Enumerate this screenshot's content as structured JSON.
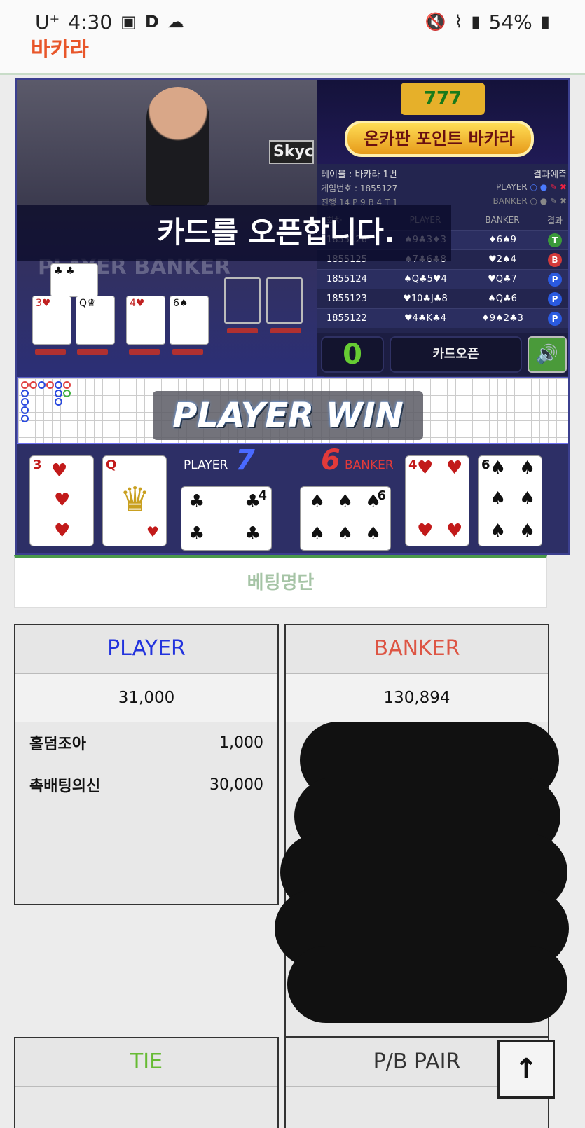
{
  "status_bar": {
    "carrier": "U⁺",
    "time": "4:30",
    "battery": "54%"
  },
  "header": {
    "logo": "바카라"
  },
  "video": {
    "announcement": "카드를 오픈합니다.",
    "watermark": "Skyc",
    "ghost_label": "PLAYER BANKER"
  },
  "banner": {
    "slots": "777",
    "title": "온카판 포인트 바카라"
  },
  "info": {
    "table": "테이블 : 바카라 1번",
    "prediction_label": "결과예측",
    "game_no": "게임번호 : 1855127",
    "player_label": "PLAYER",
    "banker_label": "BANKER",
    "progress": "진행 14  P 9  B 4  T 1",
    "columns": [
      "회차",
      "PLAYER",
      "BANKER",
      "결과"
    ],
    "rows": [
      {
        "num": "1855126",
        "player": "♠9♣3♦3",
        "banker": "♦6♠9",
        "result": "T",
        "color": "#3a9a3a"
      },
      {
        "num": "1855125",
        "player": "♠7♣6♣8",
        "banker": "♥2♠4",
        "result": "B",
        "color": "#d43a3a"
      },
      {
        "num": "1855124",
        "player": "♠Q♣5♥4",
        "banker": "♥Q♣7",
        "result": "P",
        "color": "#2a5ae0"
      },
      {
        "num": "1855123",
        "player": "♥10♣J♣8",
        "banker": "♠Q♣6",
        "result": "P",
        "color": "#2a5ae0"
      },
      {
        "num": "1855122",
        "player": "♥4♣K♣4",
        "banker": "♦9♠2♣3",
        "result": "P",
        "color": "#2a5ae0"
      }
    ]
  },
  "controls": {
    "counter": "0",
    "open_label": "카드오픈",
    "sound_icon": "speaker-icon"
  },
  "result": {
    "banner": "PLAYER WIN",
    "player_label": "PLAYER",
    "player_score": "7",
    "banker_label": "BANKER",
    "banker_score": "6",
    "player_cards": [
      {
        "rank": "3",
        "suit": "♥"
      },
      {
        "rank": "Q",
        "suit": "♥"
      },
      {
        "rank": "4",
        "suit": "♣"
      }
    ],
    "banker_cards": [
      {
        "rank": "6",
        "suit": "♠"
      },
      {
        "rank": "4",
        "suit": "♥"
      },
      {
        "rank": "6",
        "suit": "♠"
      }
    ]
  },
  "betlist": {
    "title": "베팅명단"
  },
  "columns": {
    "player": {
      "title": "PLAYER",
      "color": "#2233dd",
      "total": "31,000",
      "rows": [
        {
          "name": "홀덤조아",
          "amount": "1,000"
        },
        {
          "name": "촉배팅의신",
          "amount": "30,000"
        }
      ]
    },
    "banker": {
      "title": "BANKER",
      "color": "#dd5544",
      "total": "130,894"
    },
    "tie": {
      "title": "TIE",
      "color": "#66bb33"
    },
    "pair": {
      "title": "P/B PAIR",
      "color": "#333333"
    }
  },
  "scroll_top_icon": "arrow-up-icon"
}
